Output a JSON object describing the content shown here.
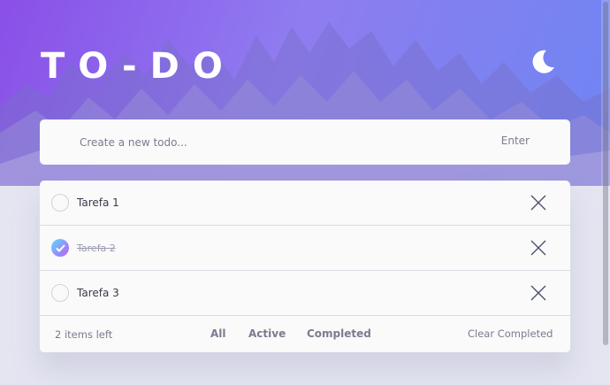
{
  "app": {
    "title": "TO-DO",
    "theme_icon": "moon-icon"
  },
  "new_todo": {
    "placeholder": "Create a new todo...",
    "value": "",
    "submit_label": "Enter"
  },
  "todos": [
    {
      "text": "Tarefa 1",
      "completed": false
    },
    {
      "text": "Tarefa 2",
      "completed": true
    },
    {
      "text": "Tarefa 3",
      "completed": false
    }
  ],
  "footer": {
    "items_left": "2 items left",
    "filters": {
      "all": "All",
      "active": "Active",
      "completed": "Completed"
    },
    "clear_label": "Clear Completed"
  },
  "colors": {
    "background": "#e4e5f1",
    "card": "#fafafa",
    "gradient_start": "#57ddff",
    "gradient_end": "#c058f3"
  }
}
